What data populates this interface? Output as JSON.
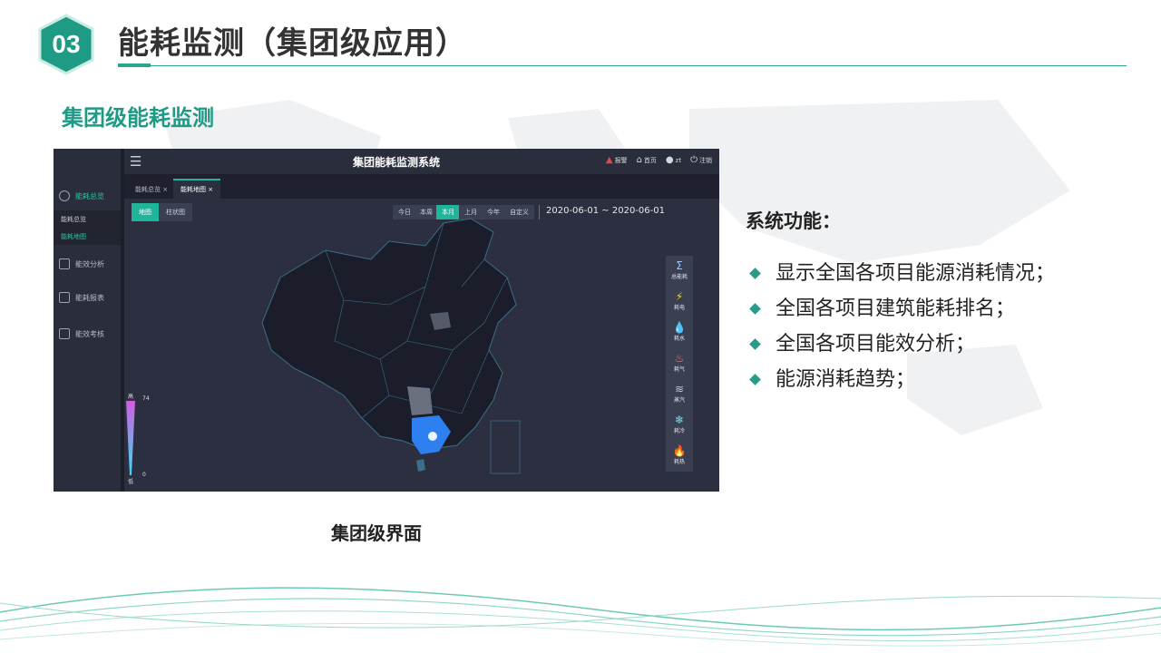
{
  "slide": {
    "badge_number": "03",
    "title": "能耗监测（集团级应用）",
    "subtitle": "集团级能耗监测",
    "caption": "集团级界面",
    "accent_color": "#2aa68f"
  },
  "features": {
    "title": "系统功能：",
    "items": [
      "显示全国各项目能源消耗情况；",
      "全国各项目建筑能耗排名；",
      "全国各项目能效分析；",
      "能源消耗趋势；"
    ]
  },
  "app": {
    "title": "集团能耗监测系统",
    "menu_icon": "hamburger-menu-icon",
    "top_right": {
      "alarm": "报警",
      "home": "首页",
      "user": "zt",
      "logout": "注销"
    },
    "tabs": [
      "能耗总览",
      "能耗地图"
    ],
    "sidebar": {
      "items": [
        "能耗总览",
        "能效分析",
        "能耗报表",
        "能效考核"
      ],
      "sub_items": [
        "能耗总览",
        "能耗地图"
      ]
    },
    "view_tabs": [
      "地图",
      "柱状图"
    ],
    "periods": [
      "今日",
      "本周",
      "本月",
      "上月",
      "今年",
      "自定义"
    ],
    "active_period": "本月",
    "date_range": "2020-06-01 ~ 2020-06-01",
    "legend": {
      "high_label": "高",
      "high_value": "74",
      "low_label": "低",
      "low_value": "0"
    },
    "energy_types": [
      {
        "icon": "sigma-icon",
        "glyph": "Σ",
        "label": "总能耗"
      },
      {
        "icon": "lightning-icon",
        "glyph": "⚡",
        "label": "耗电"
      },
      {
        "icon": "water-drop-icon",
        "glyph": "💧",
        "label": "耗水"
      },
      {
        "icon": "gas-icon",
        "glyph": "♨",
        "label": "耗气"
      },
      {
        "icon": "steam-icon",
        "glyph": "≋",
        "label": "蒸汽"
      },
      {
        "icon": "snowflake-icon",
        "glyph": "❄",
        "label": "耗冷"
      },
      {
        "icon": "flame-icon",
        "glyph": "🔥",
        "label": "耗热"
      }
    ]
  }
}
